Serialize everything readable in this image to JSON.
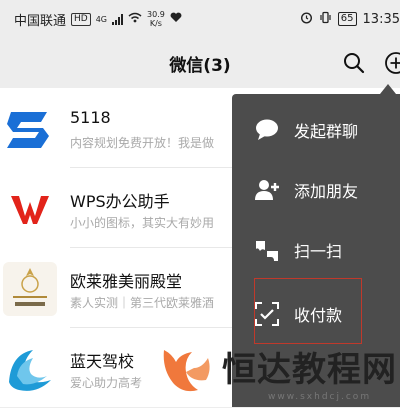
{
  "status_bar": {
    "carrier": "中国联通",
    "hd": "HD",
    "net": "4G",
    "speed_value": "30.9",
    "speed_unit": "K/s",
    "battery": "65",
    "time": "13:35"
  },
  "nav": {
    "title": "微信(3)",
    "search_icon": "search-icon",
    "add_icon": "plus-circle-icon"
  },
  "chats": [
    {
      "name": "5118",
      "preview": "内容规划免费开放！我是做",
      "avatar": "5118-logo"
    },
    {
      "name": "WPS办公助手",
      "preview": "小小的图标，其实大有妙用",
      "avatar": "wps-logo"
    },
    {
      "name": "欧莱雅美丽殿堂",
      "preview": "素人实测｜第三代欧莱雅酒",
      "avatar": "loreal-logo"
    },
    {
      "name": "蓝天驾校",
      "preview": "爱心助力高考",
      "avatar": "driving-school-logo"
    }
  ],
  "menu": {
    "items": [
      {
        "label": "发起群聊",
        "icon": "chat-bubble-icon"
      },
      {
        "label": "添加朋友",
        "icon": "add-friend-icon"
      },
      {
        "label": "扫一扫",
        "icon": "scan-icon"
      },
      {
        "label": "收付款",
        "icon": "payment-scan-icon"
      }
    ]
  },
  "watermark": {
    "text": "恒达教程网",
    "url": "www.sxhdcj.com"
  },
  "colors": {
    "menu_bg": "#4c4c4c",
    "wps_red": "#e2231a",
    "accent_blue": "#1677ff",
    "highlight": "#c0392b",
    "watermark_orange": "#f0783c"
  }
}
